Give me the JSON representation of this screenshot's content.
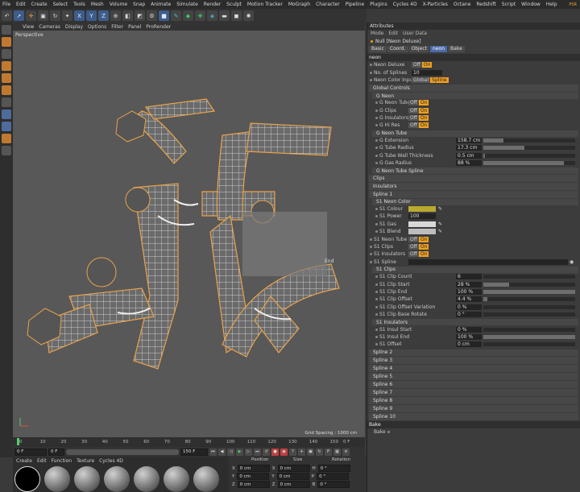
{
  "menubar": {
    "items": [
      "File",
      "Edit",
      "Create",
      "Select",
      "Tools",
      "Mesh",
      "Volume",
      "Snap",
      "Animate",
      "Simulate",
      "Render",
      "Sculpt",
      "Motion Tracker",
      "MoGraph",
      "Character",
      "Pipeline",
      "Plugins",
      "Cycles 4D",
      "X-Particles",
      "Octane",
      "Redshift",
      "Script",
      "Window",
      "Help"
    ],
    "psr": "PSR"
  },
  "toolbar": {
    "icons": [
      {
        "name": "undo-icon",
        "glyph": "↶"
      },
      {
        "name": "select-icon",
        "glyph": "➚",
        "cls": "blue"
      },
      {
        "name": "move-icon",
        "glyph": "✛",
        "cls": "orange"
      },
      {
        "name": "scale-icon",
        "glyph": "▣"
      },
      {
        "name": "rotate-icon",
        "glyph": "↻"
      },
      {
        "name": "recent-icon",
        "glyph": "✦"
      },
      {
        "name": "x-axis-icon",
        "glyph": "X",
        "cls": "blue"
      },
      {
        "name": "y-axis-icon",
        "glyph": "Y",
        "cls": "blue"
      },
      {
        "name": "z-axis-icon",
        "glyph": "Z",
        "cls": "blue"
      },
      {
        "name": "coord-system-icon",
        "glyph": "⊕"
      },
      {
        "name": "render-view-icon",
        "glyph": "◧"
      },
      {
        "name": "render-picture-icon",
        "glyph": "◩"
      },
      {
        "name": "render-settings-icon",
        "glyph": "⚙"
      },
      {
        "name": "cube-icon",
        "glyph": "■",
        "cls": "blue"
      },
      {
        "name": "pen-icon",
        "glyph": "✎",
        "cls": "teal"
      },
      {
        "name": "subdivision-icon",
        "glyph": "◆",
        "cls": "green"
      },
      {
        "name": "cloner-icon",
        "glyph": "✤",
        "cls": "green"
      },
      {
        "name": "deformer-icon",
        "glyph": "◈",
        "cls": "teal"
      },
      {
        "name": "floor-icon",
        "glyph": "▬"
      },
      {
        "name": "camera-icon",
        "glyph": "◼"
      },
      {
        "name": "light-icon",
        "glyph": "✺"
      }
    ]
  },
  "viewport": {
    "menu": [
      "View",
      "Cameras",
      "Display",
      "Options",
      "Filter",
      "Panel",
      "ProRender"
    ],
    "label": "Perspective",
    "grid_spacing": "Grid Spacing : 1000 cm",
    "end_label": "End"
  },
  "timeline": {
    "ticks": [
      "0",
      "10",
      "20",
      "30",
      "40",
      "50",
      "60",
      "70",
      "80",
      "90",
      "100",
      "110",
      "120",
      "130",
      "140",
      "150"
    ],
    "current": "0 F",
    "start": "0 F",
    "min": "0 F",
    "max": "150 F",
    "end": "150 F"
  },
  "material": {
    "menu": [
      "Create",
      "Edit",
      "Function",
      "Texture",
      "Cycles 4D"
    ]
  },
  "coords": {
    "headers": [
      "Position",
      "Size",
      "Rotation"
    ],
    "rows": [
      {
        "axis": "X",
        "pos": "0 cm",
        "saxis": "X",
        "size": "0 cm",
        "raxis": "H",
        "rot": "0 °"
      },
      {
        "axis": "Y",
        "pos": "0 cm",
        "saxis": "Y",
        "size": "0 cm",
        "raxis": "P",
        "rot": "0 °"
      },
      {
        "axis": "Z",
        "pos": "0 cm",
        "saxis": "Z",
        "size": "0 cm",
        "raxis": "B",
        "rot": "0 °"
      }
    ]
  },
  "attributes": {
    "title": "Attributes",
    "menu": [
      "Mode",
      "Edit",
      "User Data"
    ],
    "object_name": "Null [Neon Deluxe]",
    "tabs": [
      "Basic",
      "Coord.",
      "Object",
      "neon",
      "Bake"
    ],
    "active_tab": "neon",
    "section_neon": "neon",
    "neon_deluxe": {
      "label": "Neon Deluxe",
      "off": "Off",
      "on": "On"
    },
    "no_of_splines": {
      "label": "No. of Splines",
      "value": "10"
    },
    "neon_color_input": {
      "label": "Neon Color Input",
      "opt1": "Global",
      "opt2": "Spline"
    },
    "global_controls": "Global Controls",
    "g_neon": "G Neon",
    "g_neon_rows": [
      "G Neon Tube",
      "G Clips",
      "G Insulators",
      "G Hi Res"
    ],
    "g_neon_tube": "G Neon Tube",
    "g_tube_rows": [
      {
        "label": "G Extension",
        "value": "158.7 cm",
        "fill": 0.22
      },
      {
        "label": "G Tube Radius",
        "value": "17.3 cm",
        "fill": 0.45
      },
      {
        "label": "G Tube Wall Thickness",
        "value": "0.5 cm",
        "fill": 0.02
      },
      {
        "label": "G Gas Radius",
        "value": "88 %",
        "fill": 0.88
      }
    ],
    "g_neon_tube_spline": "G Neon Tube Spline",
    "clips": "Clips",
    "insulators": "Insulators",
    "spline1": "Spline 1",
    "s1_neon_color": "S1 Neon Color",
    "s1_colour": {
      "label": "S1 Colour",
      "color": "#b9a832"
    },
    "s1_power": {
      "label": "S1 Power",
      "value": "100"
    },
    "s1_gas": {
      "label": "S1 Gas",
      "color": "#d8d8d8"
    },
    "s1_blend": {
      "label": "S1 Blend",
      "color": "#bdbdbd"
    },
    "s1_toggles": [
      "S1 Neon Tube",
      "S1 Clips",
      "S1 Insulators"
    ],
    "s1_spline": "S1 Spline",
    "s1_clips": "S1 Clips",
    "s1_clip_rows": [
      {
        "label": "S1 Clip Count",
        "value": "6",
        "fill": 0
      },
      {
        "label": "S1 Clip Start",
        "value": "28 %",
        "fill": 0.28
      },
      {
        "label": "S1 Clip End",
        "value": "100 %",
        "fill": 1.0
      },
      {
        "label": "S1 Clip Offset",
        "value": "4.4 %",
        "fill": 0.04
      },
      {
        "label": "S1 Clip Offset Variation",
        "value": "0 %",
        "fill": 0
      },
      {
        "label": "S1 Clip Base Rotate",
        "value": "0 °",
        "fill": 0
      }
    ],
    "s1_insulators": "S1 Insulators",
    "s1_ins_rows": [
      {
        "label": "S1 Insul Start",
        "value": "0 %",
        "fill": 0
      },
      {
        "label": "S1 Insul End",
        "value": "100 %",
        "fill": 1.0
      },
      {
        "label": "S1 Offset",
        "value": "0 cm",
        "fill": 0
      }
    ],
    "collapsed": [
      "Spline 2",
      "Spline 3",
      "Spline 4",
      "Spline 5",
      "Spline 6",
      "Spline 7",
      "Spline 8",
      "Spline 9",
      "Spline 10"
    ],
    "bake_section": "Bake",
    "bake_label": "Bake",
    "off": "Off",
    "on": "On"
  }
}
